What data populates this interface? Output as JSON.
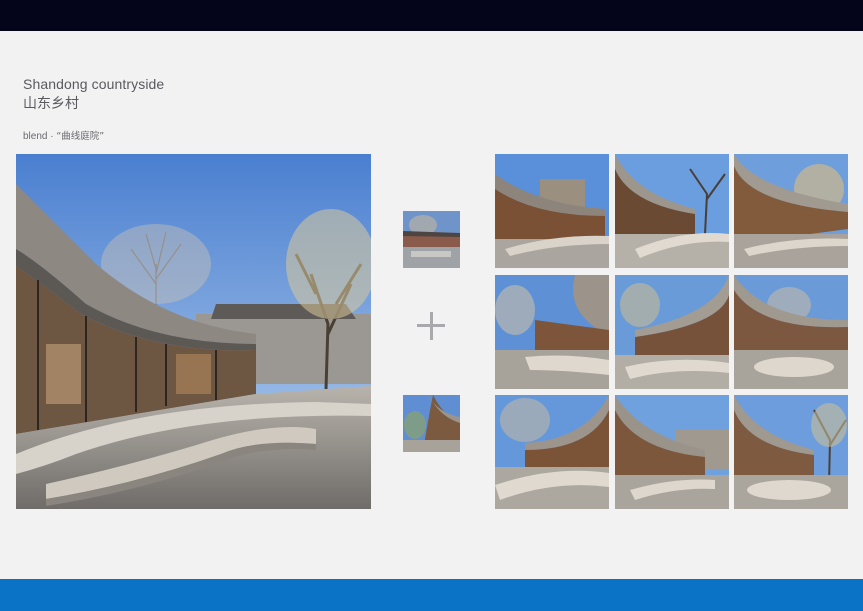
{
  "header": {
    "title_en": "Shandong countryside",
    "title_zh": "山东乡村"
  },
  "blend": {
    "prefix": "blend · ",
    "name": "“曲线庭院”"
  },
  "colors": {
    "top_bar": "#04051b",
    "bottom_bar": "#0a73c5",
    "background": "#f2f2f3",
    "plus": "#a9a9ad"
  },
  "icons": {
    "combine": "plus-icon"
  },
  "images": {
    "main": "courtyard-main-photo",
    "inputs": [
      "village-input-photo",
      "curved-roof-input-photo"
    ],
    "results_count_rows": 3,
    "results_count_cols": 3
  }
}
